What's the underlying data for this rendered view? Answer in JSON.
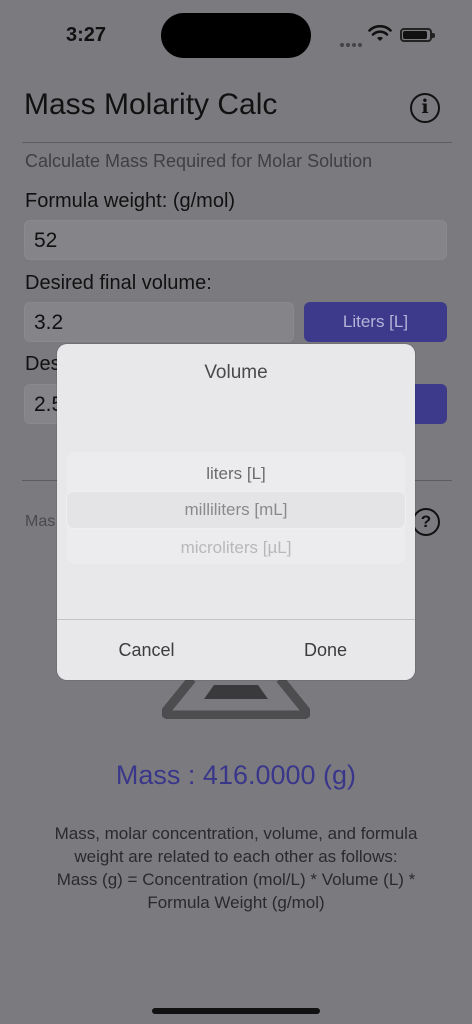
{
  "status_bar": {
    "time": "3:27",
    "icons": [
      "signal-dots-icon",
      "wifi-icon",
      "battery-icon"
    ]
  },
  "header": {
    "title": "Mass Molarity Calc",
    "info_icon": "info-icon"
  },
  "form": {
    "subtitle": "Calculate Mass Required for Molar Solution",
    "formula_weight_label": "Formula weight:  (g/mol)",
    "formula_weight_value": "52",
    "volume_label": "Desired final volume:",
    "volume_value": "3.2",
    "volume_unit_button": "Liters [L]",
    "concentration_label_partial": "Des",
    "concentration_value_partial": "2.5",
    "partial_label": "Mas",
    "help_icon": "question-icon"
  },
  "result": {
    "mass_text": "Mass : 416.0000 (g)"
  },
  "explanation": {
    "line1": "Mass, molar concentration, volume, and formula",
    "line2": "weight are related to each other as follows:",
    "line3": "Mass (g) = Concentration (mol/L) * Volume (L) *",
    "line4": "Formula Weight (g/mol)"
  },
  "picker_dialog": {
    "title": "Volume",
    "options": [
      "liters [L]",
      "milliliters [mL]",
      "microliters [µL]"
    ],
    "cancel_label": "Cancel",
    "done_label": "Done"
  },
  "colors": {
    "accent": "#3d3a8c",
    "result_text": "#3a368a"
  }
}
